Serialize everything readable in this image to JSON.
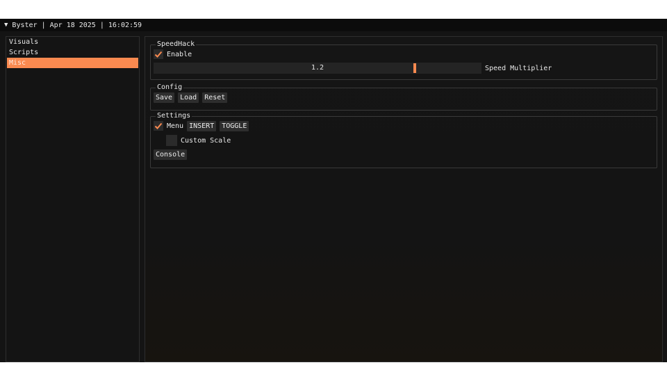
{
  "window": {
    "title": "Byster | Apr 18 2025 | 16:02:59",
    "collapse_icon": "triangle-down-icon"
  },
  "sidebar": {
    "items": [
      {
        "label": "Visuals",
        "active": false
      },
      {
        "label": "Scripts",
        "active": false
      },
      {
        "label": "Misc",
        "active": true
      }
    ]
  },
  "speedhack": {
    "title": "SpeedHack",
    "enable_label": "Enable",
    "enable_checked": true,
    "slider_value": "1.2",
    "slider_fraction": 0.8,
    "slider_label": "Speed Multiplier"
  },
  "config": {
    "title": "Config",
    "save_label": "Save",
    "load_label": "Load",
    "reset_label": "Reset"
  },
  "settings": {
    "title": "Settings",
    "menu_label": "Menu",
    "menu_checked": true,
    "insert_label": "INSERT",
    "toggle_label": "TOGGLE",
    "custom_scale_label": "Custom Scale",
    "custom_scale_checked": false,
    "console_label": "Console"
  },
  "colors": {
    "accent": "#fa8a50",
    "background": "#141414",
    "frame": "#2e2e2e"
  }
}
